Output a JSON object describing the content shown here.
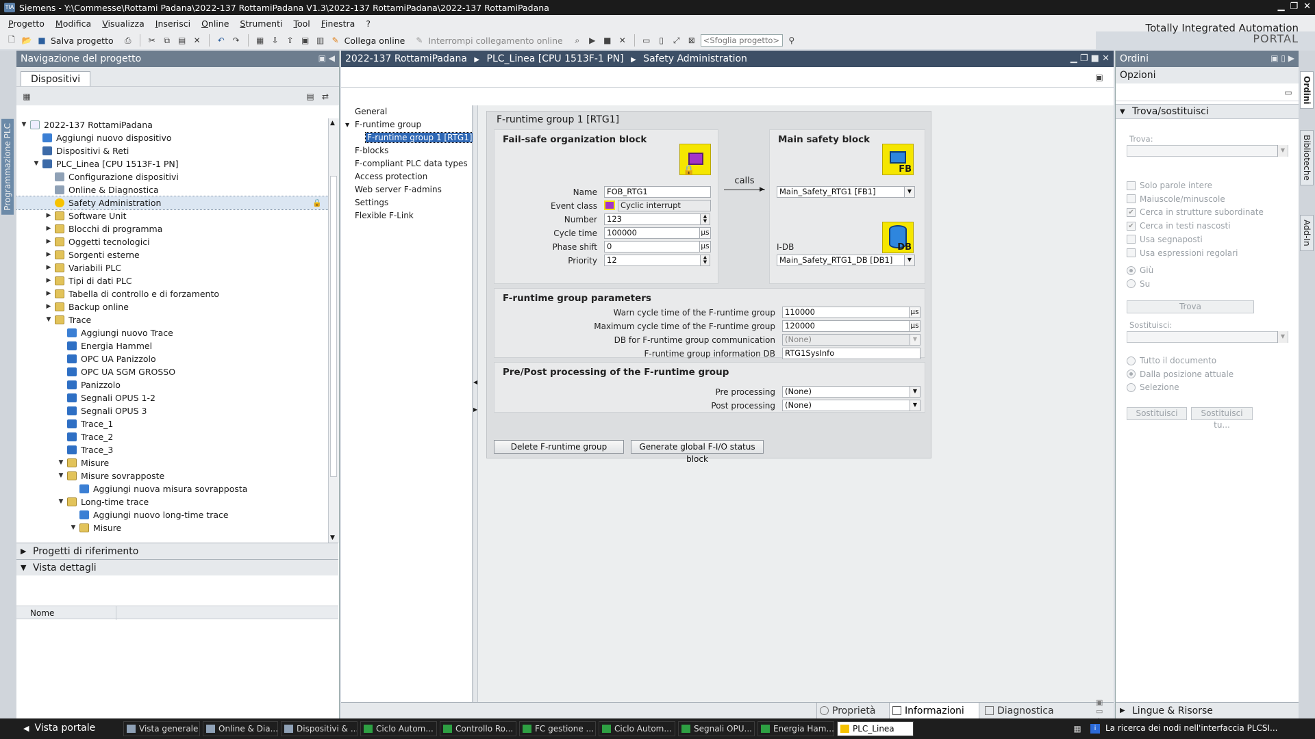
{
  "window": {
    "title": "Siemens  -  Y:\\Commesse\\Rottami Padana\\2022-137 RottamiPadana V1.3\\2022-137 RottamiPadana\\2022-137 RottamiPadana",
    "logo": "TIA"
  },
  "menu": [
    "Progetto",
    "Modifica",
    "Visualizza",
    "Inserisci",
    "Online",
    "Strumenti",
    "Tool",
    "Finestra",
    "?"
  ],
  "brand": {
    "line1": "Totally Integrated Automation",
    "line2": "PORTAL"
  },
  "toolbar": {
    "save_label": "Salva progetto",
    "connect_label": "Collega online",
    "disconnect_label": "Interrompi collegamento online",
    "search_placeholder": "<Sfoglia progetto>"
  },
  "leftstrip": {
    "label": "Programmazione PLC"
  },
  "nav": {
    "title": "Navigazione del progetto",
    "tab": "Dispositivi",
    "tree": [
      {
        "label": "2022-137 RottamiPadana",
        "level": 0,
        "arrow": "open",
        "icon": "proj"
      },
      {
        "label": "Aggiungi nuovo dispositivo",
        "level": 1,
        "arrow": "",
        "icon": "add"
      },
      {
        "label": "Dispositivi & Reti",
        "level": 1,
        "arrow": "",
        "icon": "dev"
      },
      {
        "label": "PLC_Linea [CPU 1513F-1 PN]",
        "level": 1,
        "arrow": "open",
        "icon": "dev"
      },
      {
        "label": "Configurazione dispositivi",
        "level": 2,
        "arrow": "",
        "icon": "gear"
      },
      {
        "label": "Online & Diagnostica",
        "level": 2,
        "arrow": "",
        "icon": "gear"
      },
      {
        "label": "Safety Administration",
        "level": 2,
        "arrow": "",
        "icon": "safe",
        "selected": true
      },
      {
        "label": "Software Unit",
        "level": 2,
        "arrow": "closed",
        "icon": "fold"
      },
      {
        "label": "Blocchi di programma",
        "level": 2,
        "arrow": "closed",
        "icon": "fold"
      },
      {
        "label": "Oggetti tecnologici",
        "level": 2,
        "arrow": "closed",
        "icon": "fold"
      },
      {
        "label": "Sorgenti esterne",
        "level": 2,
        "arrow": "closed",
        "icon": "fold"
      },
      {
        "label": "Variabili PLC",
        "level": 2,
        "arrow": "closed",
        "icon": "fold"
      },
      {
        "label": "Tipi di dati PLC",
        "level": 2,
        "arrow": "closed",
        "icon": "fold"
      },
      {
        "label": "Tabella di controllo e di forzamento",
        "level": 2,
        "arrow": "closed",
        "icon": "fold"
      },
      {
        "label": "Backup online",
        "level": 2,
        "arrow": "closed",
        "icon": "fold"
      },
      {
        "label": "Trace",
        "level": 2,
        "arrow": "open",
        "icon": "fold"
      },
      {
        "label": "Aggiungi nuovo Trace",
        "level": 3,
        "arrow": "",
        "icon": "add"
      },
      {
        "label": "Energia Hammel",
        "level": 3,
        "arrow": "",
        "icon": "trace"
      },
      {
        "label": "OPC UA Panizzolo",
        "level": 3,
        "arrow": "",
        "icon": "trace"
      },
      {
        "label": "OPC UA SGM GROSSO",
        "level": 3,
        "arrow": "",
        "icon": "trace"
      },
      {
        "label": "Panizzolo",
        "level": 3,
        "arrow": "",
        "icon": "trace"
      },
      {
        "label": "Segnali OPUS 1-2",
        "level": 3,
        "arrow": "",
        "icon": "trace"
      },
      {
        "label": "Segnali OPUS 3",
        "level": 3,
        "arrow": "",
        "icon": "trace"
      },
      {
        "label": "Trace_1",
        "level": 3,
        "arrow": "",
        "icon": "trace"
      },
      {
        "label": "Trace_2",
        "level": 3,
        "arrow": "",
        "icon": "trace"
      },
      {
        "label": "Trace_3",
        "level": 3,
        "arrow": "",
        "icon": "trace"
      },
      {
        "label": "Misure",
        "level": 3,
        "arrow": "open",
        "icon": "fold"
      },
      {
        "label": "Misure sovrapposte",
        "level": 3,
        "arrow": "open",
        "icon": "fold"
      },
      {
        "label": "Aggiungi nuova misura sovrapposta",
        "level": 4,
        "arrow": "",
        "icon": "add"
      },
      {
        "label": "Long-time trace",
        "level": 3,
        "arrow": "open",
        "icon": "fold"
      },
      {
        "label": "Aggiungi nuovo long-time trace",
        "level": 4,
        "arrow": "",
        "icon": "add"
      },
      {
        "label": "Misure",
        "level": 4,
        "arrow": "open",
        "icon": "fold"
      }
    ],
    "ref_projects": "Progetti di riferimento",
    "details_view": "Vista dettagli",
    "details_col": "Nome"
  },
  "main": {
    "breadcrumb": [
      "2022-137 RottamiPadana",
      "PLC_Linea [CPU 1513F-1 PN]",
      "Safety Administration"
    ],
    "sidenav": [
      {
        "label": "General",
        "indent": 0
      },
      {
        "label": "F-runtime group",
        "indent": 0,
        "arrow": true
      },
      {
        "label": "F-runtime group 1 [RTG1]",
        "indent": 1,
        "selected": true
      },
      {
        "label": "F-blocks",
        "indent": 0
      },
      {
        "label": "F-compliant PLC data types",
        "indent": 0
      },
      {
        "label": "Access protection",
        "indent": 0
      },
      {
        "label": "Web server F-admins",
        "indent": 0
      },
      {
        "label": "Settings",
        "indent": 0
      },
      {
        "label": "Flexible F-Link",
        "indent": 0
      }
    ],
    "group_title": "F-runtime group 1 [RTG1]",
    "fob": {
      "title": "Fail-safe organization block",
      "name_label": "Name",
      "name": "FOB_RTG1",
      "event_label": "Event class",
      "event": "Cyclic interrupt",
      "number_label": "Number",
      "number": "123",
      "cycle_label": "Cycle time",
      "cycle": "100000",
      "phase_label": "Phase shift",
      "phase": "0",
      "priority_label": "Priority",
      "priority": "12",
      "unit": "µs"
    },
    "calls": "calls",
    "msb": {
      "title": "Main safety block",
      "block": "Main_Safety_RTG1 [FB1]",
      "idb_label": "I-DB",
      "idb": "Main_Safety_RTG1_DB [DB1]",
      "fb_tag": "FB",
      "db_tag": "DB"
    },
    "params": {
      "title": "F-runtime group parameters",
      "warn_label": "Warn cycle time of the F-runtime group",
      "warn": "110000",
      "max_label": "Maximum cycle time of the F-runtime group",
      "max": "120000",
      "comm_label": "DB for F-runtime group communication",
      "comm": "(None)",
      "info_label": "F-runtime group information DB",
      "info": "RTG1SysInfo",
      "unit": "µs"
    },
    "prepost": {
      "title": "Pre/Post processing of the F-runtime group",
      "pre_label": "Pre processing",
      "pre": "(None)",
      "post_label": "Post processing",
      "post": "(None)"
    },
    "buttons": {
      "delete": "Delete F-runtime group",
      "generate": "Generate global F-I/O status block"
    }
  },
  "bottomtabs": {
    "props": "Proprietà",
    "info": "Informazioni",
    "diag": "Diagnostica"
  },
  "right": {
    "title": "Ordini",
    "sub": "Opzioni",
    "section": "Trova/sostituisci",
    "find_label": "Trova:",
    "checks": [
      {
        "label": "Solo parole intere",
        "checked": false
      },
      {
        "label": "Maiuscole/minuscole",
        "checked": false
      },
      {
        "label": "Cerca in strutture subordinate",
        "checked": true
      },
      {
        "label": "Cerca in testi nascosti",
        "checked": true
      },
      {
        "label": "Usa segnaposti",
        "checked": false
      },
      {
        "label": "Usa espressioni regolari",
        "checked": false
      }
    ],
    "dir": [
      {
        "label": "Giù",
        "on": true
      },
      {
        "label": "Su",
        "on": false
      }
    ],
    "find_btn": "Trova",
    "replace_label": "Sostituisci:",
    "scope": [
      {
        "label": "Tutto il documento",
        "on": false
      },
      {
        "label": "Dalla posizione attuale",
        "on": true
      },
      {
        "label": "Selezione",
        "on": false
      }
    ],
    "replace_btn": "Sostituisci",
    "replace_all_btn": "Sostituisci tu...",
    "langs": "Lingue & Risorse"
  },
  "rightstrip": [
    "Ordini",
    "Biblioteche",
    "Add-In"
  ],
  "taskbar": {
    "portal": "Vista portale",
    "items": [
      "Vista generale",
      "Online & Dia...",
      "Dispositivi & ...",
      "Ciclo Autom...",
      "Controllo Ro...",
      "FC gestione ...",
      "Ciclo Autom...",
      "Segnali OPU...",
      "Energia Ham...",
      "PLC_Linea"
    ],
    "status": "La ricerca dei nodi nell'interfaccia PLCSI..."
  }
}
